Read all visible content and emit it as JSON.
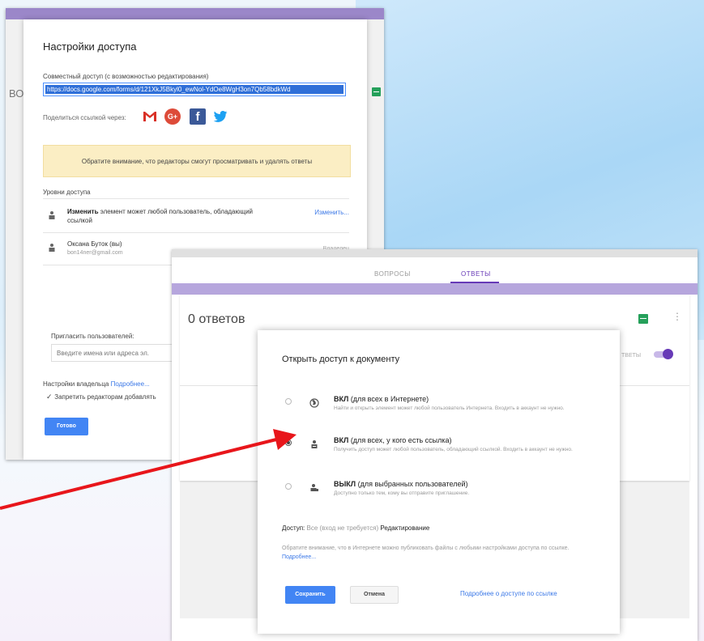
{
  "share_dialog": {
    "title": "Настройки доступа",
    "link_label": "Совместный доступ (с возможностью редактирования)",
    "link_value": "https://docs.google.com/forms/d/121XkJ5Bkyl0_ewNol-YdOe8WgH3on7Qb58bdkWd",
    "share_via_label": "Поделиться ссылкой через:",
    "share_icons": [
      "gmail-icon",
      "google-plus-icon",
      "facebook-icon",
      "twitter-icon"
    ],
    "notice": "Обратите внимание, что редакторы смогут просматривать и удалять ответы",
    "levels_label": "Уровни доступа",
    "rows": [
      {
        "bold": "Изменить",
        "text": " элемент может любой пользователь, обладающий ссылкой",
        "action": "Изменить..."
      },
      {
        "name": "Оксана Буток (вы)",
        "email": "bon14ner@gmail.com",
        "role": "Владелец"
      }
    ],
    "invite_label": "Пригласить пользователей:",
    "invite_placeholder": "Введите имена или адреса эл.",
    "owner_settings": "Настройки владельца",
    "owner_more": "Подробнее...",
    "checkbox_label": "Запретить редакторам добавлять",
    "done_button": "Готово",
    "background_text": "ВО"
  },
  "forms_page": {
    "tab_questions": "ВОПРОСЫ",
    "tab_answers": "ОТВЕТЫ",
    "count_title": "0 ответов",
    "accepting_label": "ТВЕТЫ",
    "more_menu": "⋮"
  },
  "link_dialog": {
    "title": "Открыть доступ к документу",
    "options": [
      {
        "label": "ВКЛ",
        "label_rest": " (для всех в Интернете)",
        "desc": "Найти и открыть элемент может любой пользователь Интернета. Входить в аккаунт не нужно.",
        "selected": false
      },
      {
        "label": "ВКЛ",
        "label_rest": " (для всех, у кого есть ссылка)",
        "desc": "Получить доступ может любой пользователь, обладающий ссылкой. Входить в аккаунт не нужно.",
        "selected": true
      },
      {
        "label": "ВЫКЛ",
        "label_rest": " (для выбранных пользователей)",
        "desc": "Доступно только тем, кому вы отправите приглашение.",
        "selected": false
      }
    ],
    "access_label": "Доступ:",
    "access_value": "Все (вход не требуется)",
    "access_mode": "Редактирование",
    "note": "Обратите внимание, что в Интернете можно публиковать файлы с любыми настройками доступа по ссылке.",
    "note_link": "Подробнее...",
    "save_button": "Сохранить",
    "cancel_button": "Отмена",
    "more_link": "Подробнее о доступе по ссылке"
  },
  "colors": {
    "arrow": "#e8161b",
    "accent_purple": "#673ab7",
    "button_blue": "#4285f4",
    "notice_yellow": "#fbeec4"
  }
}
